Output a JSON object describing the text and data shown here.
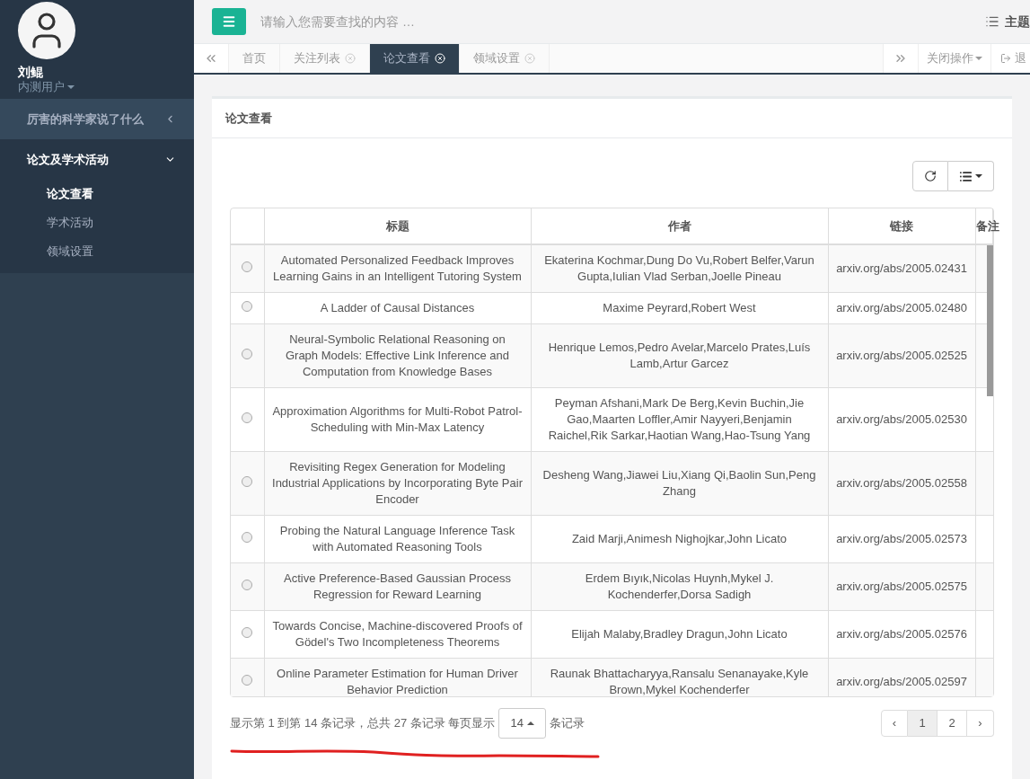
{
  "user": {
    "name": "刘鲲",
    "role": "内测用户"
  },
  "sidebar": {
    "items": [
      {
        "label": "厉害的科学家说了什么",
        "expanded": false
      },
      {
        "label": "论文及学术活动",
        "expanded": true,
        "children": [
          {
            "label": "论文查看",
            "selected": true
          },
          {
            "label": "学术活动",
            "selected": false
          },
          {
            "label": "领域设置",
            "selected": false
          }
        ]
      }
    ]
  },
  "topbar": {
    "search_placeholder": "请输入您需要查找的内容 …",
    "theme_label": "主题"
  },
  "tabs": [
    {
      "label": "首页",
      "selected": false,
      "closable": false
    },
    {
      "label": "关注列表",
      "selected": false,
      "closable": true
    },
    {
      "label": "论文查看",
      "selected": true,
      "closable": true
    },
    {
      "label": "领域设置",
      "selected": false,
      "closable": true
    }
  ],
  "tab_actions": {
    "close_menu": "关闭操作",
    "logout": "退"
  },
  "panel": {
    "title": "论文查看"
  },
  "table": {
    "columns": [
      "标题",
      "作者",
      "链接",
      "备注"
    ],
    "rows": [
      {
        "selected": false,
        "title": "Automated Personalized Feedback Improves Learning Gains in an Intelligent Tutoring System",
        "authors": "Ekaterina Kochmar,Dung Do Vu,Robert Belfer,Varun Gupta,Iulian Vlad Serban,Joelle Pineau",
        "link": "arxiv.org/abs/2005.02431"
      },
      {
        "selected": false,
        "title": "A Ladder of Causal Distances",
        "authors": "Maxime Peyrard,Robert West",
        "link": "arxiv.org/abs/2005.02480"
      },
      {
        "selected": false,
        "title": "Neural-Symbolic Relational Reasoning on Graph Models: Effective Link Inference and Computation from Knowledge Bases",
        "authors": "Henrique Lemos,Pedro Avelar,Marcelo Prates,Luís Lamb,Artur Garcez",
        "link": "arxiv.org/abs/2005.02525"
      },
      {
        "selected": false,
        "title": "Approximation Algorithms for Multi-Robot Patrol-Scheduling with Min-Max Latency",
        "authors": "Peyman Afshani,Mark De Berg,Kevin Buchin,Jie Gao,Maarten Loffler,Amir Nayyeri,Benjamin Raichel,Rik Sarkar,Haotian Wang,Hao-Tsung Yang",
        "link": "arxiv.org/abs/2005.02530"
      },
      {
        "selected": false,
        "title": "Revisiting Regex Generation for Modeling Industrial Applications by Incorporating Byte Pair Encoder",
        "authors": "Desheng Wang,Jiawei Liu,Xiang Qi,Baolin Sun,Peng Zhang",
        "link": "arxiv.org/abs/2005.02558"
      },
      {
        "selected": false,
        "title": "Probing the Natural Language Inference Task with Automated Reasoning Tools",
        "authors": "Zaid Marji,Animesh Nighojkar,John Licato",
        "link": "arxiv.org/abs/2005.02573"
      },
      {
        "selected": false,
        "title": "Active Preference-Based Gaussian Process Regression for Reward Learning",
        "authors": "Erdem Bıyık,Nicolas Huynh,Mykel J. Kochenderfer,Dorsa Sadigh",
        "link": "arxiv.org/abs/2005.02575"
      },
      {
        "selected": false,
        "title": "Towards Concise, Machine-discovered Proofs of Gödel's Two Incompleteness Theorems",
        "authors": "Elijah Malaby,Bradley Dragun,John Licato",
        "link": "arxiv.org/abs/2005.02576"
      },
      {
        "selected": false,
        "title": "Online Parameter Estimation for Human Driver Behavior Prediction",
        "authors": "Raunak Bhattacharyya,Ransalu Senanayake,Kyle Brown,Mykel Kochenderfer",
        "link": "arxiv.org/abs/2005.02597"
      }
    ]
  },
  "footer": {
    "summary": "显示第 1 到第 14 条记录，总共 27 条记录 每页显示",
    "page_size": "14",
    "summary_suffix": "条记录"
  },
  "pagination": {
    "prev": "‹",
    "next": "›",
    "pages": [
      {
        "label": "1",
        "selected": true
      },
      {
        "label": "2",
        "selected": false
      }
    ]
  }
}
